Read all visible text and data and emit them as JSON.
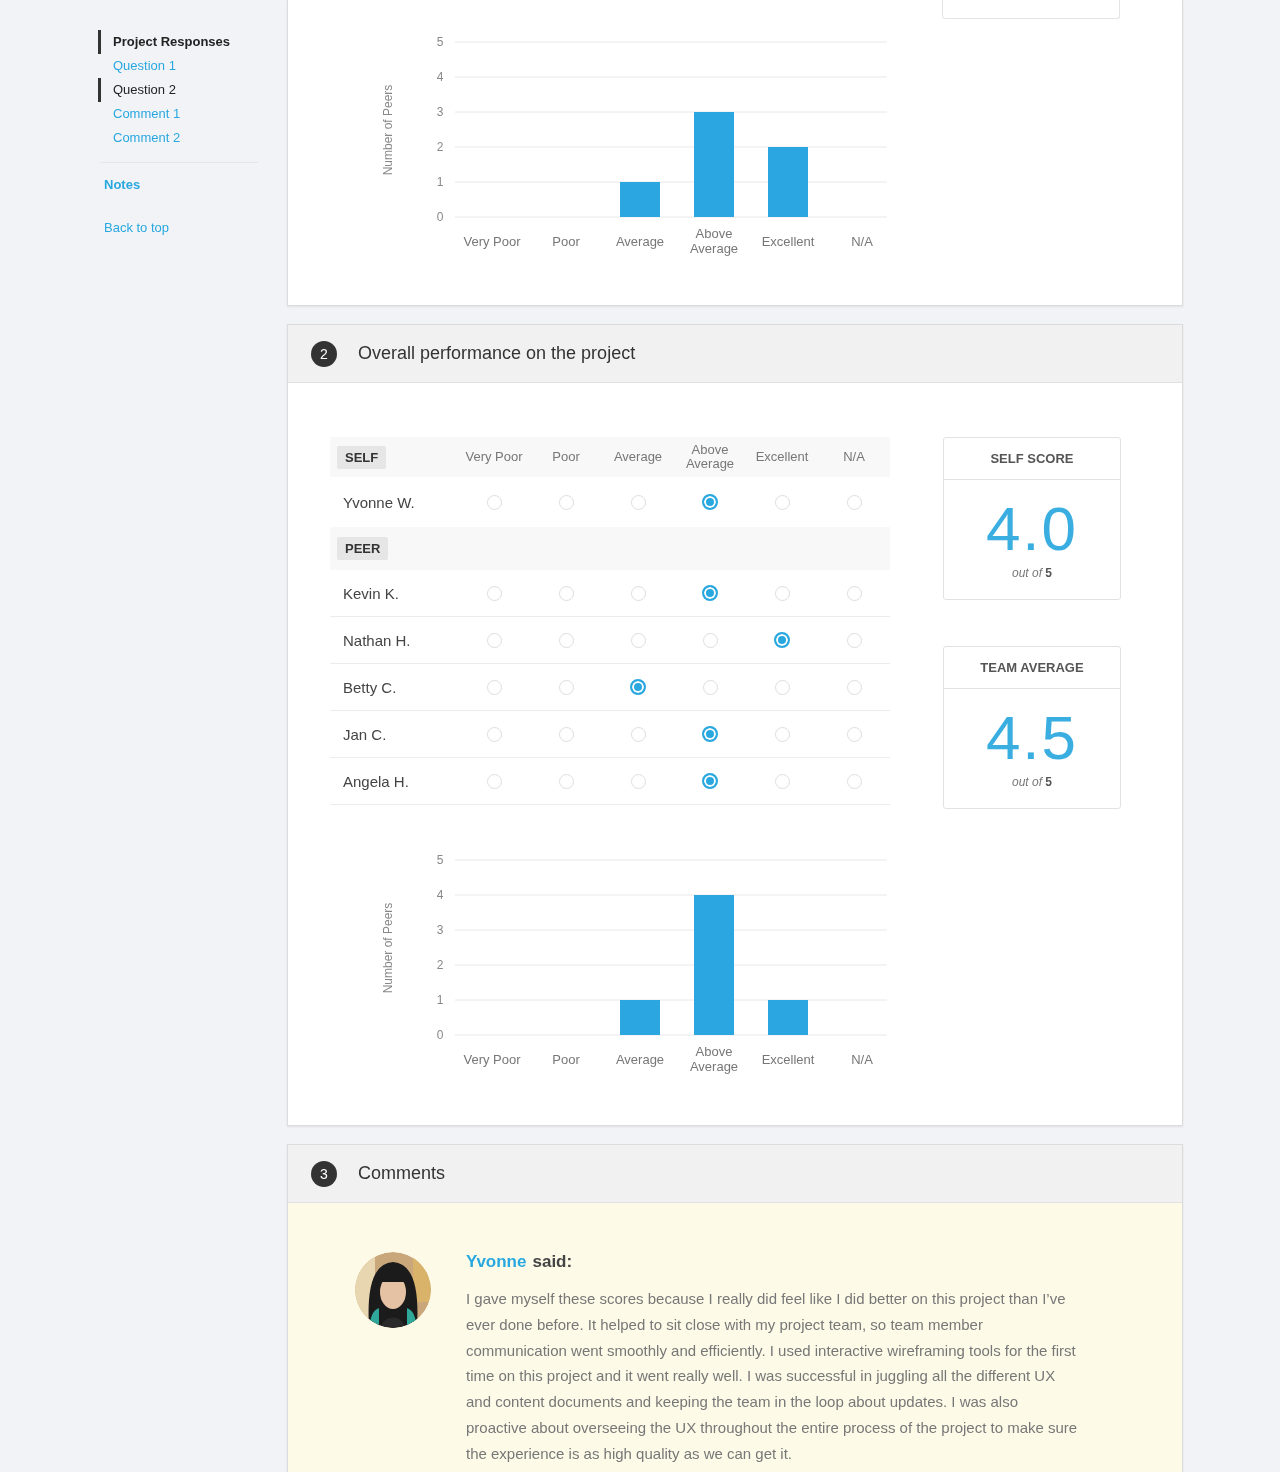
{
  "nav": {
    "title": {
      "label": "Project Responses",
      "selected": true
    },
    "items": [
      {
        "label": "Question 1",
        "selected": false
      },
      {
        "label": "Question 2",
        "selected": true
      },
      {
        "label": "Comment 1",
        "selected": false
      },
      {
        "label": "Comment 2",
        "selected": false
      }
    ],
    "links": [
      {
        "label": "Notes",
        "kind": "section"
      },
      {
        "label": "Back to top",
        "kind": "link"
      }
    ]
  },
  "question_1": {
    "chart_data": {
      "type": "bar",
      "ylabel": "Number of Peers",
      "categories": [
        "Very Poor",
        "Poor",
        "Average",
        "Above Average",
        "Excellent",
        "N/A"
      ],
      "values": [
        0,
        0,
        1,
        3,
        2,
        0
      ],
      "grid": true,
      "ylim": [
        0,
        5
      ],
      "yticks": [
        0,
        1,
        2,
        3,
        4,
        5
      ]
    }
  },
  "question_2": {
    "number": "2",
    "title": "Overall performance on the project",
    "table": {
      "columns": [
        "Very Poor",
        "Poor",
        "Average",
        "Above Average",
        "Excellent",
        "N/A"
      ],
      "sections": [
        {
          "label": "SELF",
          "rows": [
            {
              "name": "Yvonne W.",
              "options": [
                {
                  "selected": false
                },
                {
                  "selected": false
                },
                {
                  "selected": false
                },
                {
                  "selected": true
                },
                {
                  "selected": false
                },
                {
                  "selected": false
                }
              ]
            }
          ]
        },
        {
          "label": "PEER",
          "rows": [
            {
              "name": "Kevin K.",
              "options": [
                {
                  "selected": false
                },
                {
                  "selected": false
                },
                {
                  "selected": false
                },
                {
                  "selected": true
                },
                {
                  "selected": false
                },
                {
                  "selected": false
                }
              ]
            },
            {
              "name": "Nathan H.",
              "options": [
                {
                  "selected": false
                },
                {
                  "selected": false
                },
                {
                  "selected": false
                },
                {
                  "selected": false
                },
                {
                  "selected": true
                },
                {
                  "selected": false
                }
              ]
            },
            {
              "name": "Betty C.",
              "options": [
                {
                  "selected": false
                },
                {
                  "selected": false
                },
                {
                  "selected": true
                },
                {
                  "selected": false
                },
                {
                  "selected": false
                },
                {
                  "selected": false
                }
              ]
            },
            {
              "name": "Jan C.",
              "options": [
                {
                  "selected": false
                },
                {
                  "selected": false
                },
                {
                  "selected": false
                },
                {
                  "selected": true
                },
                {
                  "selected": false
                },
                {
                  "selected": false
                }
              ]
            },
            {
              "name": "Angela H.",
              "options": [
                {
                  "selected": false
                },
                {
                  "selected": false
                },
                {
                  "selected": false
                },
                {
                  "selected": true
                },
                {
                  "selected": false
                },
                {
                  "selected": false
                }
              ]
            }
          ]
        }
      ]
    },
    "scores": [
      {
        "title": "SELF SCORE",
        "value": "4.0",
        "caption": "*out of* **5**"
      },
      {
        "title": "TEAM AVERAGE",
        "value": "4.5",
        "caption": "*out of* **5**"
      }
    ],
    "chart_data": {
      "type": "bar",
      "ylabel": "Number of Peers",
      "categories": [
        "Very Poor",
        "Poor",
        "Average",
        "Above Average",
        "Excellent",
        "N/A"
      ],
      "values": [
        0,
        0,
        1,
        4,
        1,
        0
      ],
      "grid": true,
      "ylim": [
        0,
        5
      ],
      "yticks": [
        0,
        1,
        2,
        3,
        4,
        5
      ]
    }
  },
  "comments": {
    "number": "3",
    "title": "Comments",
    "items": [
      {
        "author": "Yvonne",
        "verb": "said:",
        "text": "I gave myself these scores because I really did feel like I did better on this project than I’ve ever done before. It helped to sit close with my project team, so team member communication went smoothly and efficiently. I used interactive wireframing tools for the first time on this project and it went really well. I was successful in juggling all the different UX and content documents and keeping the team in the loop about updates. I was also proactive about overseeing the UX throughout the entire process of the project to make sure the experience is as high quality as we can get it."
      }
    ]
  }
}
